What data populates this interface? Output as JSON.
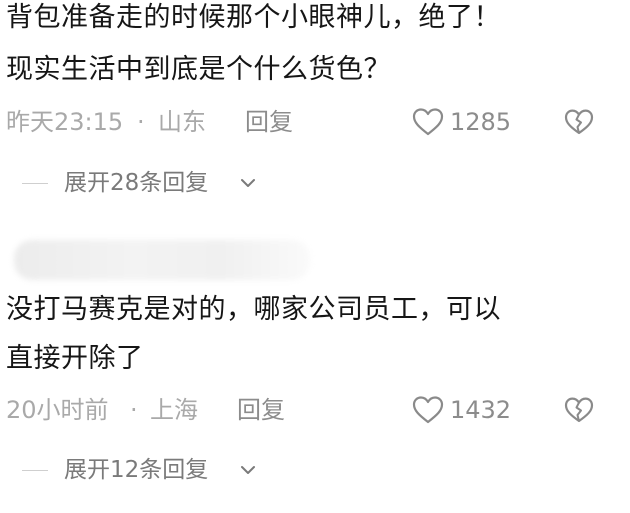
{
  "comments": [
    {
      "text_lines": [
        "背包准备走的时候那个小眼神儿，绝了！",
        "现实生活中到底是个什么货色？"
      ],
      "time": "昨天23:15",
      "dot": "·",
      "location": "山东",
      "reply_label": "回复",
      "likes": "1285",
      "expand_label": "展开28条回复"
    },
    {
      "text_lines": [
        "没打马赛克是对的，哪家公司员工，可以",
        "直接开除了"
      ],
      "time": "20小时前",
      "dot": "·",
      "location": "上海",
      "reply_label": "回复",
      "likes": "1432",
      "expand_label": "展开12条回复"
    }
  ],
  "icons": {
    "like": "heart-outline-icon",
    "dislike": "broken-heart-icon",
    "expand": "chevron-down-icon"
  },
  "colors": {
    "text": "#161616",
    "meta": "#a9a9a9",
    "action": "#8c8c8c",
    "icon": "#8a8a8a"
  }
}
